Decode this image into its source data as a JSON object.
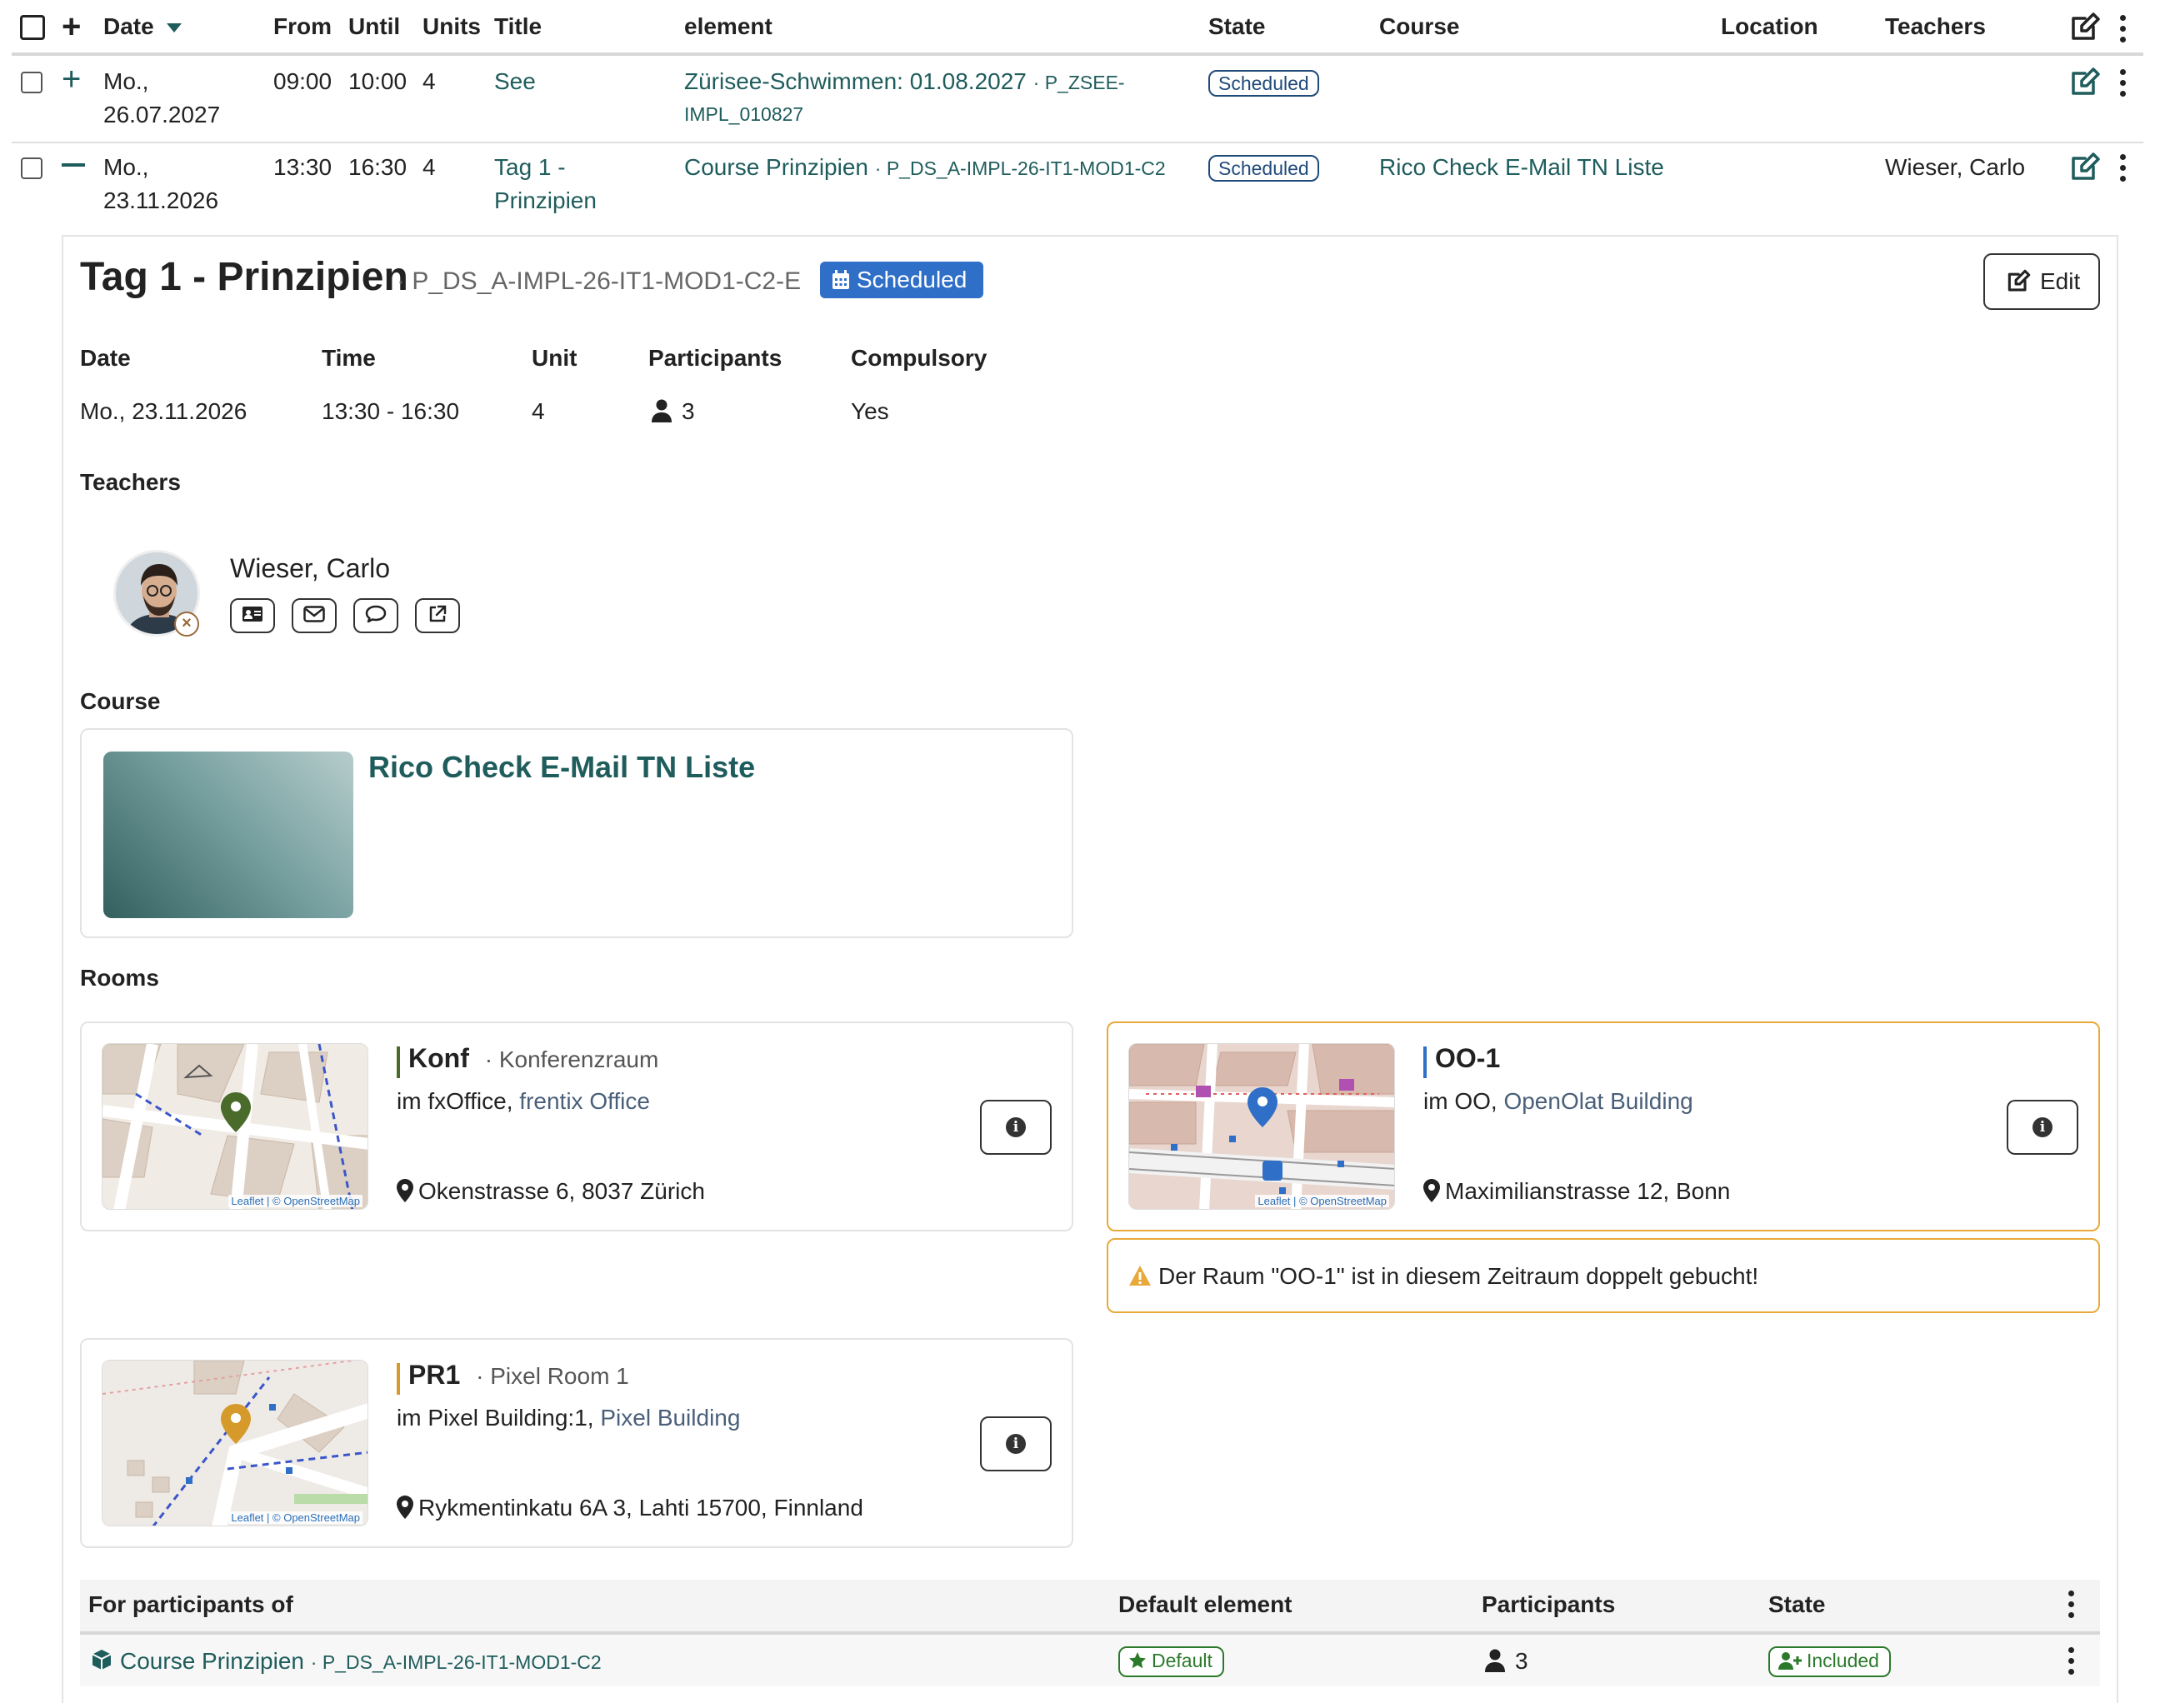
{
  "table": {
    "headers": {
      "date": "Date",
      "from": "From",
      "until": "Until",
      "units": "Units",
      "title": "Title",
      "element": "element",
      "state": "State",
      "course": "Course",
      "location": "Location",
      "teachers": "Teachers"
    },
    "rows": [
      {
        "date_line1": "Mo.,",
        "date_line2": "26.07.2027",
        "from": "09:00",
        "until": "10:00",
        "units": "4",
        "title_line1": "See",
        "title_line2": "",
        "element": "Zürisee-Schwimmen: 01.08.2027",
        "element_code_line1": "· P_ZSEE-",
        "element_code_line2": "IMPL_010827",
        "state": "Scheduled",
        "course": "",
        "location": "",
        "teachers": ""
      },
      {
        "date_line1": "Mo.,",
        "date_line2": "23.11.2026",
        "from": "13:30",
        "until": "16:30",
        "units": "4",
        "title_line1": "Tag 1 -",
        "title_line2": "Prinzipien",
        "element": "Course Prinzipien",
        "element_code_line1": "· P_DS_A-IMPL-26-IT1-MOD1-C2",
        "element_code_line2": "",
        "state": "Scheduled",
        "course": "Rico Check E-Mail TN Liste",
        "location": "",
        "teachers": "Wieser, Carlo"
      }
    ]
  },
  "detail": {
    "title": "Tag 1 - Prinzipien",
    "code": "· P_DS_A-IMPL-26-IT1-MOD1-C2-E",
    "status": "Scheduled",
    "edit_label": "Edit",
    "facts": {
      "labels": {
        "date": "Date",
        "time": "Time",
        "unit": "Unit",
        "participants": "Participants",
        "compulsory": "Compulsory"
      },
      "values": {
        "date": "Mo., 23.11.2026",
        "time": "13:30 - 16:30",
        "unit": "4",
        "participants": "3",
        "compulsory": "Yes"
      }
    },
    "teachers_heading": "Teachers",
    "teacher": {
      "name": "Wieser, Carlo"
    },
    "course_heading": "Course",
    "course": {
      "title": "Rico Check E-Mail TN Liste"
    },
    "rooms_heading": "Rooms",
    "rooms": [
      {
        "name": "Konf",
        "type": "· Konferenzraum",
        "building_prefix": "im fxOffice,",
        "building": "frentix Office",
        "address": "Okenstrasse 6, 8037 Zürich",
        "accent": "#4a6b2a"
      },
      {
        "name": "OO-1",
        "type": "",
        "building_prefix": "im OO,",
        "building": "OpenOlat Building",
        "address": "Maximilianstrasse 12, Bonn",
        "accent": "#2f6fc7"
      },
      {
        "name": "PR1",
        "type": "· Pixel Room 1",
        "building_prefix": "im Pixel Building:1,",
        "building": "Pixel Building",
        "address": "Rykmentinkatu 6A 3, Lahti 15700, Finnland",
        "accent": "#d69a2a"
      }
    ],
    "map_attribution": "Leaflet | © OpenStreetMap",
    "warning": "Der Raum \"OO-1\" ist in diesem Zeitraum doppelt gebucht!",
    "participants_table": {
      "headers": {
        "for": "For participants of",
        "default": "Default element",
        "participants": "Participants",
        "state": "State"
      },
      "row": {
        "element": "Course Prinzipien",
        "code": "· P_DS_A-IMPL-26-IT1-MOD1-C2",
        "default": "Default",
        "participants": "3",
        "state": "Included"
      }
    }
  },
  "colors": {
    "teal": "#1f5c5c",
    "scheduled_blue": "#2f6fc7",
    "warning": "#e8a93a",
    "success": "#2b7a2b"
  }
}
